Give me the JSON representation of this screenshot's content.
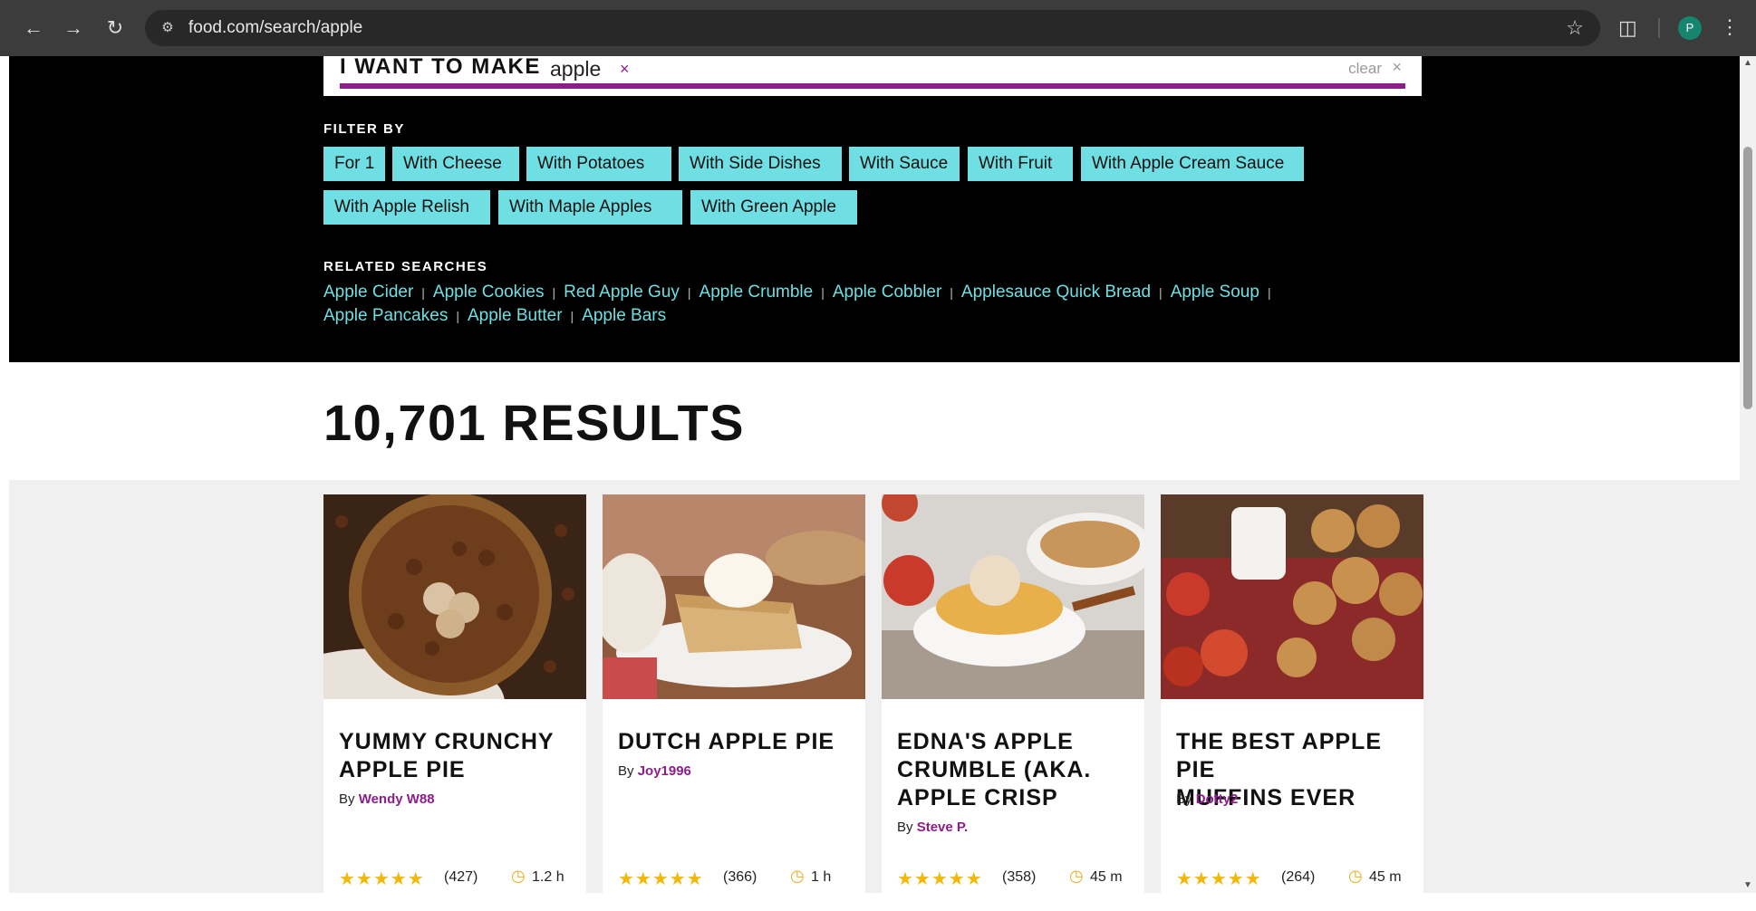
{
  "browser": {
    "url": "food.com/search/apple",
    "avatar_letter": "P"
  },
  "search": {
    "label": "I WANT TO MAKE",
    "term": "apple",
    "remove_glyph": "×",
    "clear_label": "clear",
    "clear_glyph": "×"
  },
  "filters": {
    "heading": "FILTER BY",
    "chips": [
      "For 1",
      "With Cheese",
      "With Potatoes",
      "With Side Dishes",
      "With Sauce",
      "With Fruit",
      "With Apple Cream Sauce",
      "With Apple Relish",
      "With Maple Apples",
      "With Green Apple"
    ]
  },
  "related": {
    "heading": "RELATED SEARCHES",
    "links": [
      "Apple Cider",
      "Apple Cookies",
      "Red Apple Guy",
      "Apple Crumble",
      "Apple Cobbler",
      "Applesauce Quick Bread",
      "Apple Soup",
      "Apple Pancakes",
      "Apple Butter",
      "Apple Bars"
    ],
    "separator": "|"
  },
  "results": {
    "count_text": "10,701 RESULTS"
  },
  "cards": [
    {
      "title_lines": [
        "YUMMY CRUNCHY",
        "APPLE PIE"
      ],
      "by": "By",
      "author": "Wendy W88",
      "rating": 5,
      "reviews": "(427)",
      "time": "1.2 h"
    },
    {
      "title_lines": [
        "DUTCH APPLE PIE"
      ],
      "by": "By",
      "author": "Joy1996",
      "rating": 5,
      "reviews": "(366)",
      "time": "1 h"
    },
    {
      "title_lines": [
        "EDNA'S APPLE",
        "CRUMBLE (AKA.",
        "APPLE CRISP"
      ],
      "by": "By",
      "author": "Steve P.",
      "rating": 5,
      "reviews": "(358)",
      "time": "45 m"
    },
    {
      "title_lines": [
        "THE BEST APPLE PIE",
        "MUFFINS EVER"
      ],
      "by": "By",
      "author": "Dotty2",
      "rating": 5,
      "reviews": "(264)",
      "time": "45 m"
    }
  ],
  "colors": {
    "chip_bg": "#6fdfe3",
    "accent_purple": "#8b1e8a",
    "star_gold": "#f2b807"
  },
  "icons": {
    "back": "back-arrow-icon",
    "forward": "forward-arrow-icon",
    "reload": "reload-icon",
    "site_info": "site-settings-icon",
    "bookmark": "star-bookmark-icon",
    "extensions": "puzzle-icon",
    "menu": "kebab-menu-icon",
    "clock": "clock-icon"
  }
}
